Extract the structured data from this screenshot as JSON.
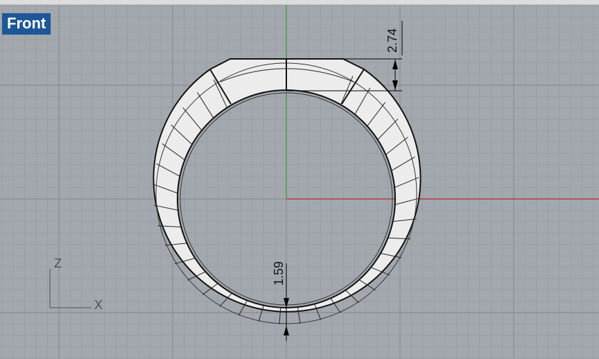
{
  "viewport": {
    "name": "Front"
  },
  "dimensions": {
    "top_thickness": "2.74",
    "bottom_thickness": "1.59"
  },
  "axes": {
    "z_label": "Z",
    "x_label": "X",
    "x_axis_color": "#b03030",
    "y_axis_color": "#3a9a3a"
  }
}
